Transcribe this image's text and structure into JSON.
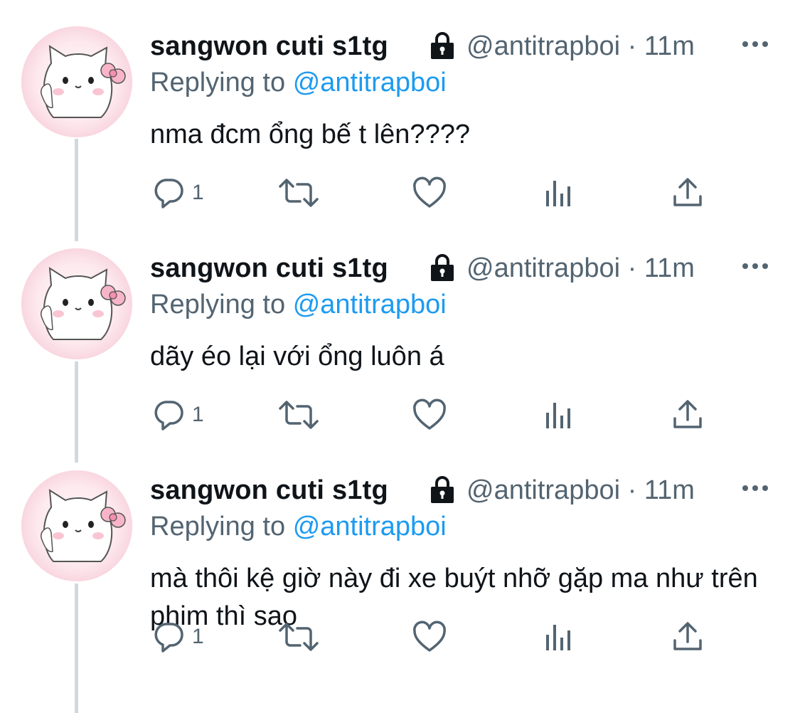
{
  "thread": [
    {
      "author_name": "sangwon cuti s1tg",
      "handle": "@antitrapboi",
      "separator": "·",
      "time": "11m",
      "replying_prefix": "Replying to",
      "replying_handle": "@antitrapboi",
      "text": "nma đcm ổng bế t lên????",
      "reply_count": "1"
    },
    {
      "author_name": "sangwon cuti s1tg",
      "handle": "@antitrapboi",
      "separator": "·",
      "time": "11m",
      "replying_prefix": "Replying to",
      "replying_handle": "@antitrapboi",
      "text": "dãy éo lại với ổng luôn á",
      "reply_count": "1"
    },
    {
      "author_name": "sangwon cuti s1tg",
      "handle": "@antitrapboi",
      "separator": "·",
      "time": "11m",
      "replying_prefix": "Replying to",
      "replying_handle": "@antitrapboi",
      "text": "mà thôi kệ giờ này đi xe buýt nhỡ gặp ma như trên phim thì sao",
      "reply_count": "1"
    }
  ],
  "icons": {
    "lock": "lock-icon",
    "more": "more-options-icon",
    "reply": "reply-icon",
    "retweet": "retweet-icon",
    "like": "like-icon",
    "views": "analytics-icon",
    "share": "share-icon"
  },
  "colors": {
    "text": "#0f1419",
    "secondary": "#536471",
    "link": "#1d9bf0",
    "thread_line": "#cfd9de"
  }
}
